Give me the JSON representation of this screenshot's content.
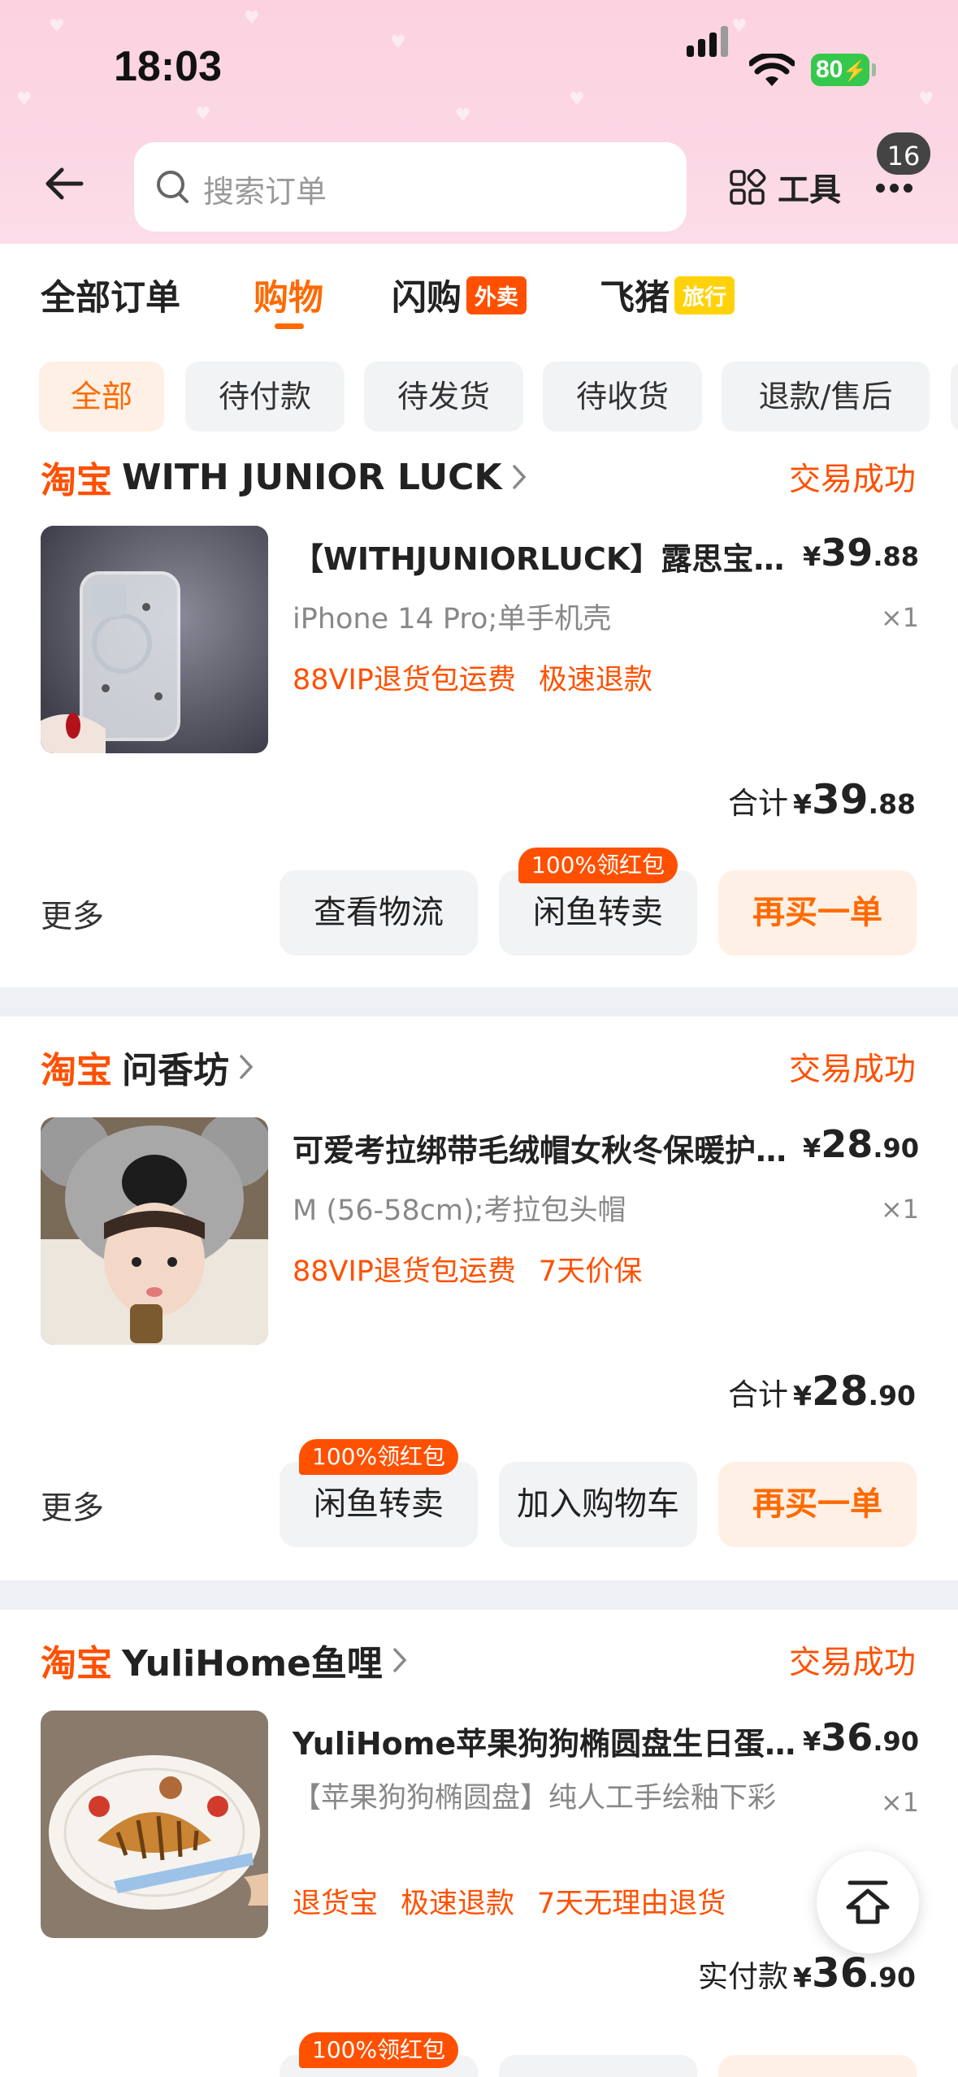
{
  "status_bar": {
    "time": "18:03",
    "battery": "80"
  },
  "header": {
    "search_placeholder": "搜索订单",
    "tools_label": "工具",
    "notification_count": "16"
  },
  "tabs": [
    {
      "label": "全部订单",
      "tag": ""
    },
    {
      "label": "购物",
      "tag": "",
      "active": true
    },
    {
      "label": "闪购",
      "tag": "外卖"
    },
    {
      "label": "飞猪",
      "tag": "旅行"
    }
  ],
  "filters": [
    "全部",
    "待付款",
    "待发货",
    "待收货",
    "退款/售后"
  ],
  "orders": [
    {
      "platform": "淘宝",
      "shop": "WITH JUNIOR LUCK",
      "status": "交易成功",
      "title": "【WITHJUNIORLUCK】露思宝宝可爱手机壳",
      "price_symbol": "¥",
      "price_int": "39",
      "price_dec": ".88",
      "spec": "iPhone 14 Pro;单手机壳",
      "qty": "×1",
      "perks": [
        "88VIP退货包运费",
        "极速退款"
      ],
      "total_label": "合计",
      "total_int": "39",
      "total_dec": ".88",
      "more": "更多",
      "buttons": [
        "查看物流",
        "闲鱼转卖",
        "再买一单"
      ],
      "promo": "100%领红包"
    },
    {
      "platform": "淘宝",
      "shop": "问香坊",
      "status": "交易成功",
      "title": "可爱考拉绑带毛绒帽女秋冬保暖护耳帽",
      "price_symbol": "¥",
      "price_int": "28",
      "price_dec": ".90",
      "spec": "M (56-58cm);考拉包头帽",
      "qty": "×1",
      "perks": [
        "88VIP退货包运费",
        "7天价保"
      ],
      "total_label": "合计",
      "total_int": "28",
      "total_dec": ".90",
      "more": "更多",
      "buttons": [
        "闲鱼转卖",
        "加入购物车",
        "再买一单"
      ],
      "promo": "100%领红包"
    },
    {
      "platform": "淘宝",
      "shop": "YuliHome鱼哩",
      "status": "交易成功",
      "title": "YuliHome苹果狗狗椭圆盘生日蛋糕盘",
      "price_symbol": "¥",
      "price_int": "36",
      "price_dec": ".90",
      "spec": "【苹果狗狗椭圆盘】纯人工手绘釉下彩",
      "qty": "×1",
      "perks": [
        "退货宝",
        "极速退款",
        "7天无理由退货"
      ],
      "total_label": "实付款",
      "total_int": "36",
      "total_dec": ".90",
      "promo": "100%领红包"
    }
  ]
}
